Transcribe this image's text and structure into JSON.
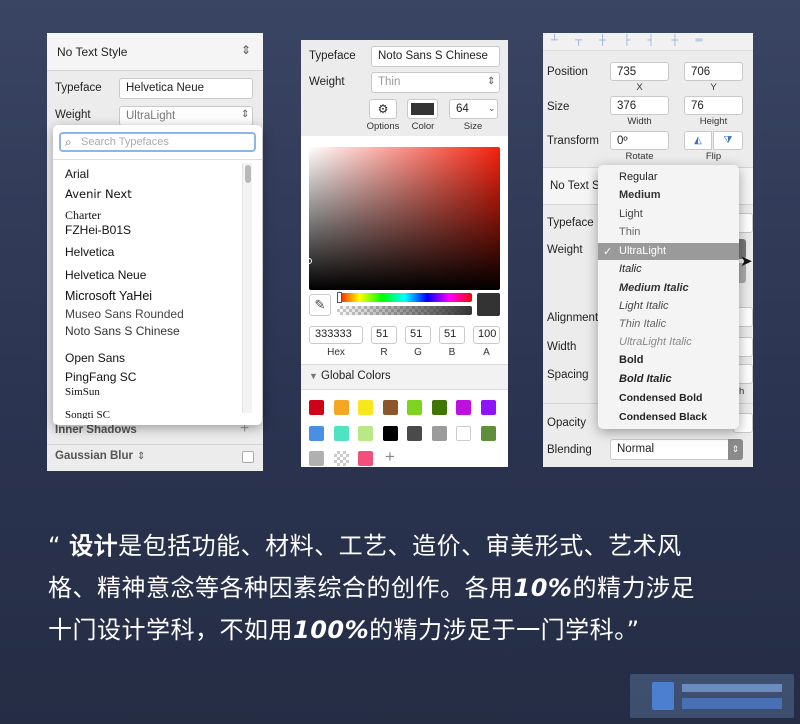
{
  "panel1": {
    "text_style": "No Text Style",
    "typeface_label": "Typeface",
    "typeface_value": "Helvetica Neue",
    "weight_label": "Weight",
    "weight_value": "UltraLight",
    "search_placeholder": "Search Typefaces",
    "fonts": [
      "Arial",
      "Avenir Next",
      "Charter",
      "FZHei-B01S",
      "Helvetica",
      "Helvetica Neue",
      "Microsoft YaHei",
      "Museo Sans Rounded",
      "Noto Sans S Chinese",
      "Open Sans",
      "PingFang SC",
      "SimSun",
      "Songti SC"
    ],
    "inner_shadows": "Inner Shadows",
    "gaussian_blur": "Gaussian Blur"
  },
  "panel2": {
    "typeface_label": "Typeface",
    "typeface_value": "Noto Sans S Chinese",
    "weight_label": "Weight",
    "weight_value": "Thin",
    "size_value": "64",
    "options_label": "Options",
    "color_label": "Color",
    "size_label": "Size",
    "hex": "333333",
    "r": "51",
    "g": "51",
    "b": "51",
    "a": "100",
    "hex_label": "Hex",
    "r_label": "R",
    "g_label": "G",
    "b_label": "B",
    "a_label": "A",
    "global_colors": "Global Colors",
    "swatches": [
      "#d0021b",
      "#f5a623",
      "#f8e71c",
      "#8b572a",
      "#7ed321",
      "#417505",
      "#bd10e0",
      "#9013fe",
      "#4a90e2",
      "#50e3c2",
      "#b8e986",
      "#000000",
      "#4a4a4a",
      "#9b9b9b",
      "#ffffff",
      "#5f8f3a"
    ],
    "swatches2": [
      "#b0b0b0",
      "checker",
      "#f0507a"
    ]
  },
  "panel3": {
    "position_label": "Position",
    "x_value": "735",
    "y_value": "706",
    "x_label": "X",
    "y_label": "Y",
    "size_label": "Size",
    "width_value": "376",
    "height_value": "76",
    "width_label": "Width",
    "height_label": "Height",
    "transform_label": "Transform",
    "rotate_value": "0º",
    "rotate_label": "Rotate",
    "flip_label": "Flip",
    "text_style": "No Text S",
    "typeface_label": "Typeface",
    "weight_label": "Weight",
    "alignment_label": "Alignment",
    "width2_label": "Width",
    "spacing_label": "Spacing",
    "ph_text": "ph",
    "opacity_label": "Opacity",
    "blending_label": "Blending",
    "blending_value": "Normal",
    "weights": [
      "Regular",
      "Medium",
      "Light",
      "Thin",
      "UltraLight",
      "Italic",
      "Medium Italic",
      "Light Italic",
      "Thin Italic",
      "UltraLight Italic",
      "Bold",
      "Bold Italic",
      "Condensed Bold",
      "Condensed Black"
    ],
    "selected_weight": "UltraLight"
  },
  "quote": {
    "open": "“",
    "bold": "设计",
    "line1": "是包括功能、材料、工艺、造价、审美形式、艺术风",
    "line2a": "格、精神意念等各种因素综合的创作。各用",
    "pct1": "10%",
    "line2b": "的精力涉足",
    "line3a": "十门设计学科，不如用",
    "pct2": "100%",
    "line3b": "的精力涉足于一门学科。",
    "close": "”"
  },
  "colors": {
    "accent": "#ffffff",
    "background": "#2e3753",
    "selection": "#9a9a9a"
  }
}
